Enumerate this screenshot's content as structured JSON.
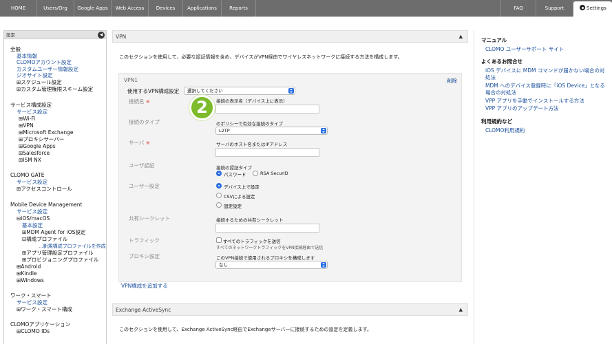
{
  "topnav": {
    "items": [
      "HOME",
      "Users/Org",
      "Google Apps",
      "Web Access",
      "Devices",
      "Applications",
      "Reports",
      "FAQ",
      "Support"
    ],
    "settings_tab": "Settings"
  },
  "sidebar": {
    "header": "設定",
    "overall": {
      "title": "全般",
      "items": [
        "基本情報",
        "CLOMOアカウント設定",
        "カスタムユーザー情報設定",
        "ジオサイト設定",
        "スケジュール設定",
        "カスタム管理権限スキーム設定"
      ]
    },
    "service": {
      "title": "サービス構成設定",
      "link": "サービス設定",
      "items": [
        "Wi-Fi",
        "VPN",
        "Microsoft Exchange",
        "プロキシサーバー",
        "Google Apps",
        "Salesforce",
        "ISM NX"
      ]
    },
    "gate": {
      "title": "CLOMO GATE",
      "link": "サービス設定",
      "items": [
        "アクセスコントロール"
      ]
    },
    "mdm": {
      "title": "Mobile Device Management",
      "link": "サービス設定",
      "ios": "iOS/macOS",
      "ios_items": [
        "基本設定",
        "MDM Agent for iOS設定",
        "構成プロファイル",
        "...新規構成プロファイルを作成",
        "アプリ管理設定プロファイル",
        "プロビジョニングプロファイル"
      ],
      "others": [
        "Android",
        "Kindle",
        "Windows"
      ]
    },
    "work": {
      "title": "ワーク・スマート",
      "link": "サービス設定",
      "items": [
        "ワーク・スマート構成"
      ]
    },
    "apps": {
      "title": "CLOMOアプリケーション",
      "items": [
        "CLOMO IDs"
      ]
    }
  },
  "main": {
    "vpn_section": {
      "title": "VPN",
      "description": "このセクションを使用して、必要な認証情報を含め、デバイスがVPN経由でワイヤレスネットワークに接続する方法を構成します。",
      "box_title": "VPN1",
      "delete_label": "削除",
      "vpn_config": {
        "label": "使用するVPN構成設定",
        "value": "選択してください"
      },
      "connection_name": {
        "label": "接続名",
        "required_mark": "※",
        "description": "接続の表示名（デバイス上に表示）",
        "value": ""
      },
      "connection_type": {
        "label": "接続のタイプ",
        "description": "のポリシーで有効な接続のタイプ",
        "value": "L2TP"
      },
      "server": {
        "label": "サーバ",
        "required_mark": "※",
        "description": "サーバのホスト名またはIPアドレス",
        "value": ""
      },
      "user_auth": {
        "label": "ユーザ認証",
        "description": "接続の認証タイプ",
        "options": [
          "パスワード",
          "RSA SecurID"
        ],
        "selected": "パスワード"
      },
      "user_setting": {
        "label": "ユーザー設定",
        "options": [
          "デバイス上で設定",
          "CSVによる設定",
          "固定設定"
        ],
        "selected": "デバイス上で設定"
      },
      "shared_secret": {
        "label": "共有シークレット",
        "description": "接続するための共有シークレット",
        "value": ""
      },
      "traffic": {
        "label": "トラフィック",
        "checkbox_label": "すべてのトラフィックを送信",
        "note": "すべてのネットワークトラフィックをVPN接続経由で送信"
      },
      "proxy": {
        "label": "プロキシ設定",
        "description": "このVPN接続で使用されるプロキシを構成します",
        "value": "なし"
      },
      "add_link": "VPN構成を追加する",
      "step_badge": "2"
    },
    "exchange_section": {
      "title": "Exchange ActiveSync",
      "description": "このセクションを使用して、Exchange ActiveSync経由でExchangeサーバーに接続するための設定を定義します。"
    }
  },
  "rightbar": {
    "manual": {
      "title": "マニュアル",
      "links": [
        "CLOMO ユーザーサポート サイト"
      ]
    },
    "faq": {
      "title": "よくあるお問合せ",
      "links": [
        "iOS デバイスに MDM コマンドが届かない場合の対",
        "処法",
        "MDM へのデバイス登録時に「iOS Device」となる",
        "場合の対処法",
        "VPP アプリを手動でインストールする方法",
        "VPP アプリのアップデート方法"
      ]
    },
    "terms": {
      "title": "利用規約など",
      "links": [
        "CLOMO利用規約"
      ]
    }
  },
  "colors": {
    "nav_bg": "#6d6d6d",
    "link": "#1a4f9c",
    "required": "#e0453a",
    "badge": "#7dbb2a",
    "select_arrow": "#2a6ee0"
  }
}
